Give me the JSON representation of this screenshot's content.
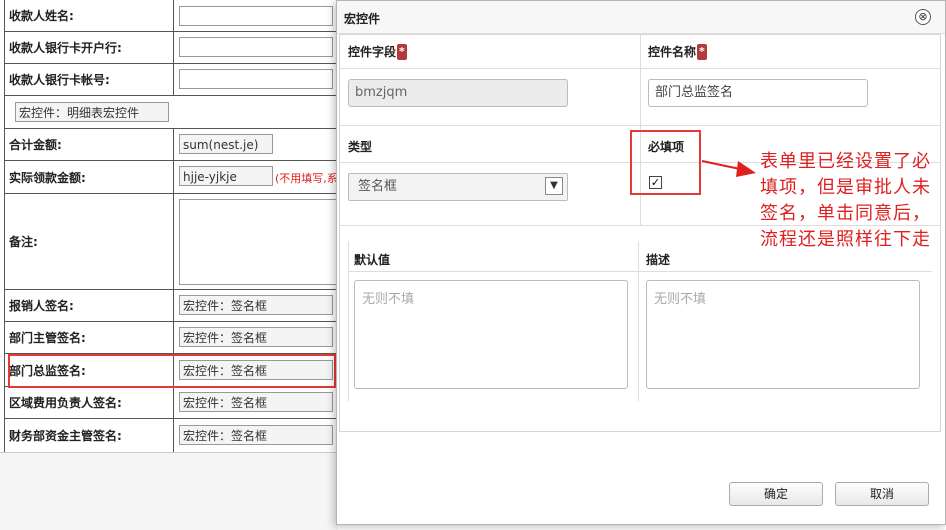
{
  "form": {
    "rows": [
      {
        "label": "收款人姓名:",
        "value": ""
      },
      {
        "label": "收款人银行卡开户行:",
        "value": ""
      },
      {
        "label": "收款人银行卡帐号:",
        "value": ""
      },
      {
        "label": "",
        "value": "宏控件：明细表宏控件"
      },
      {
        "label": "合计金额:",
        "value": "sum(nest.je)"
      },
      {
        "label": "实际领款金额:",
        "value": "hjje-yjkje",
        "note": "(不用填写,系"
      },
      {
        "label": "备注:",
        "value": ""
      },
      {
        "label": "报销人签名:",
        "value": "宏控件：签名框"
      },
      {
        "label": "部门主管签名:",
        "value": "宏控件：签名框"
      },
      {
        "label": "部门总监签名:",
        "value": "宏控件：签名框"
      },
      {
        "label": "区域费用负责人签名:",
        "value": "宏控件：签名框"
      },
      {
        "label": "财务部资金主管签名:",
        "value": "宏控件：签名框"
      }
    ]
  },
  "dialog": {
    "title": "宏控件",
    "close_icon": "⊗",
    "field_label": "控件字段",
    "name_label": "控件名称",
    "required_mark": "*",
    "field_value": "bmzjqm",
    "name_value": "部门总监签名",
    "type_label": "类型",
    "type_value": "签名框",
    "required_label": "必填项",
    "required_checked": true,
    "default_label": "默认值",
    "default_placeholder": "无则不填",
    "desc_label": "描述",
    "desc_placeholder": "无则不填",
    "ok_label": "确定",
    "cancel_label": "取消"
  },
  "annotation": {
    "text": "表单里已经设置了必填项，但是审批人未签名，单击同意后，流程还是照样往下走",
    "color": "#e02020"
  }
}
